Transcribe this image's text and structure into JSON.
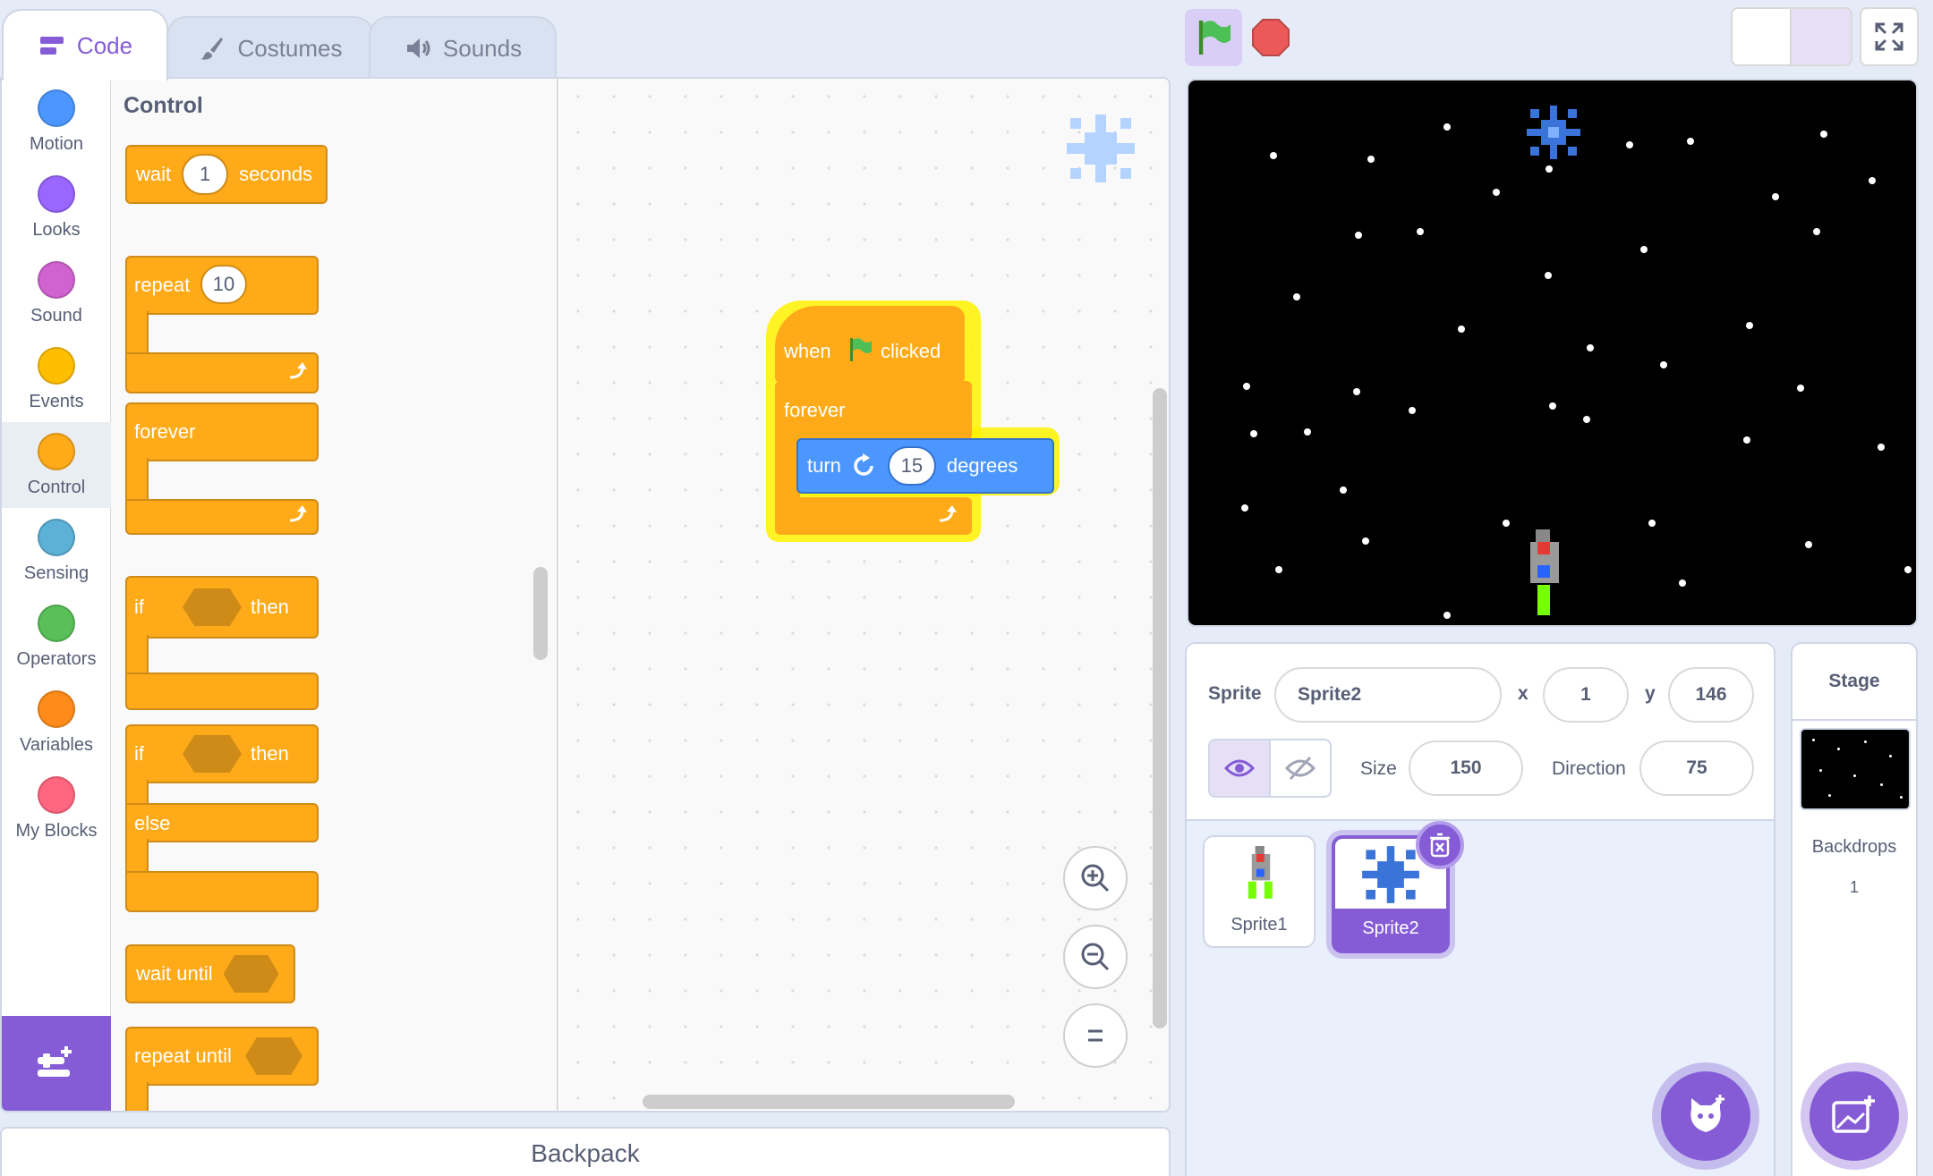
{
  "tabs": [
    {
      "label": "Code",
      "icon": "code-icon"
    },
    {
      "label": "Costumes",
      "icon": "brush-icon"
    },
    {
      "label": "Sounds",
      "icon": "speaker-icon"
    }
  ],
  "categories": [
    {
      "label": "Motion",
      "color": "#4c97ff"
    },
    {
      "label": "Looks",
      "color": "#9966ff"
    },
    {
      "label": "Sound",
      "color": "#cf63cf"
    },
    {
      "label": "Events",
      "color": "#ffbf00"
    },
    {
      "label": "Control",
      "color": "#ffab19"
    },
    {
      "label": "Sensing",
      "color": "#5cb1d6"
    },
    {
      "label": "Operators",
      "color": "#59c059"
    },
    {
      "label": "Variables",
      "color": "#ff8c1a"
    },
    {
      "label": "My Blocks",
      "color": "#ff6680"
    }
  ],
  "selected_category": "Control",
  "palette": {
    "heading": "Control",
    "wait": {
      "label": "wait",
      "value": "1",
      "unit": "seconds"
    },
    "repeat": {
      "label": "repeat",
      "value": "10"
    },
    "forever": {
      "label": "forever"
    },
    "if_then": {
      "if": "if",
      "then": "then"
    },
    "if_else": {
      "if": "if",
      "then": "then",
      "else": "else"
    },
    "wait_until": {
      "label": "wait until"
    },
    "repeat_until": {
      "label": "repeat until"
    }
  },
  "script": {
    "hat": {
      "when": "when",
      "clicked": "clicked"
    },
    "forever": "forever",
    "turn": {
      "label": "turn",
      "value": "15",
      "unit": "degrees"
    }
  },
  "backpack": "Backpack",
  "sprite_info": {
    "sprite_label": "Sprite",
    "sprite_name": "Sprite2",
    "x_label": "x",
    "x": "1",
    "y_label": "y",
    "y": "146",
    "size_label": "Size",
    "size": "150",
    "direction_label": "Direction",
    "direction": "75"
  },
  "sprites": [
    {
      "name": "Sprite1",
      "selected": false
    },
    {
      "name": "Sprite2",
      "selected": true
    }
  ],
  "stage_panel": {
    "title": "Stage",
    "backdrops_label": "Backdrops",
    "backdrops_count": "1"
  },
  "colors": {
    "accent": "#855cd6",
    "control": "#ffab19",
    "motion": "#4c97ff",
    "highlight": "#fff200"
  }
}
